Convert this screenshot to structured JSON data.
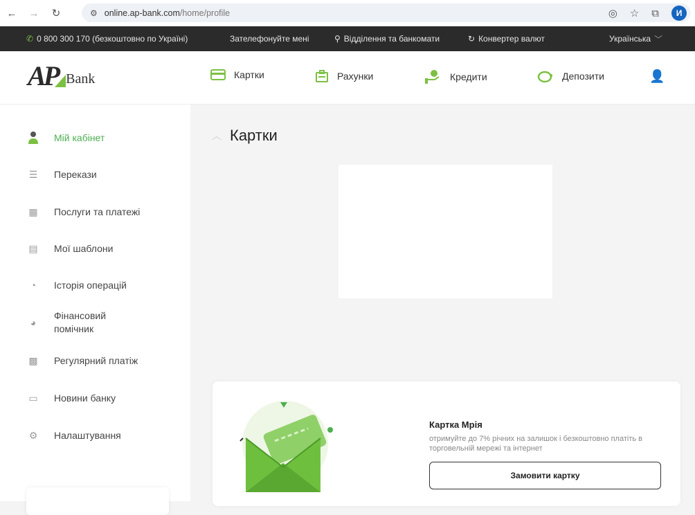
{
  "browser": {
    "url_host": "online.ap-bank.com",
    "url_path": "/home/profile",
    "profile_initial": "И"
  },
  "topbar": {
    "phone": "0 800 300 170 (безкоштовно по Україні)",
    "call_me": "Зателефонуйте мені",
    "branches": "Відділення та банкомати",
    "converter": "Конвертер валют",
    "language": "Українська"
  },
  "header": {
    "logo_ap": "AP",
    "logo_bank": "Bank",
    "nav": {
      "cards": "Картки",
      "accounts": "Рахунки",
      "credits": "Кредити",
      "deposits": "Депозити"
    }
  },
  "sidebar": {
    "items": [
      {
        "label": "Мій кабінет",
        "icon": "user-icon"
      },
      {
        "label": "Перекази",
        "icon": "transfer-icon"
      },
      {
        "label": "Послуги та платежі",
        "icon": "building-icon"
      },
      {
        "label": "Мої шаблони",
        "icon": "templates-icon"
      },
      {
        "label": "Історія операцій",
        "icon": "history-icon"
      },
      {
        "label": "Фінансовий",
        "label2": "помічник",
        "icon": "pie-chart-icon"
      },
      {
        "label": "Регулярний платіж",
        "icon": "calendar-icon"
      },
      {
        "label": "Новини банку",
        "icon": "news-icon"
      },
      {
        "label": "Налаштування",
        "icon": "gear-icon"
      }
    ]
  },
  "main": {
    "title": "Картки",
    "promo": {
      "title": "Картка Мрія",
      "description": "отримуйте до 7% річних на залишок і безкоштовно платіть в торговельній мережі та інтернет",
      "button": "Замовити картку"
    }
  },
  "colors": {
    "accent_green": "#7cc043",
    "active_green": "#4caf50",
    "topbar_dark": "#2b2b2b"
  }
}
